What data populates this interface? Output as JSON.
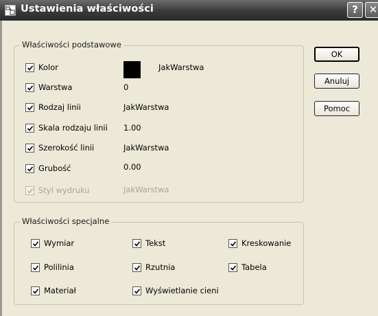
{
  "window": {
    "title": "Ustawienia właściwości",
    "help_glyph": "?",
    "close_glyph": "✕"
  },
  "basic": {
    "legend": "Właściwości podstawowe",
    "items": [
      {
        "label": "Kolor",
        "value": "JakWarstwa",
        "checked": true,
        "enabled": true
      },
      {
        "label": "Warstwa",
        "value": "0",
        "checked": true,
        "enabled": true
      },
      {
        "label": "Rodzaj linii",
        "value": "JakWarstwa",
        "checked": true,
        "enabled": true
      },
      {
        "label": "Skala rodzaju linii",
        "value": "1.00",
        "checked": true,
        "enabled": true
      },
      {
        "label": "Szerokość linii",
        "value": "JakWarstwa",
        "checked": true,
        "enabled": true
      },
      {
        "label": "Grubość",
        "value": "0.00",
        "checked": true,
        "enabled": true
      },
      {
        "label": "Styl wydruku",
        "value": "JakWarstwa",
        "checked": true,
        "enabled": false
      }
    ],
    "color_swatch": "#000000"
  },
  "special": {
    "legend": "Właściwości specjalne",
    "items": [
      {
        "label": "Wymiar",
        "checked": true
      },
      {
        "label": "Tekst",
        "checked": true
      },
      {
        "label": "Kreskowanie",
        "checked": true
      },
      {
        "label": "Polilinia",
        "checked": true
      },
      {
        "label": "Rzutnia",
        "checked": true
      },
      {
        "label": "Tabela",
        "checked": true
      },
      {
        "label": "Materiał",
        "checked": true
      },
      {
        "label": "Wyświetlanie cieni",
        "checked": true
      }
    ]
  },
  "buttons": {
    "ok": "OK",
    "cancel": "Anuluj",
    "help": "Pomoc"
  }
}
